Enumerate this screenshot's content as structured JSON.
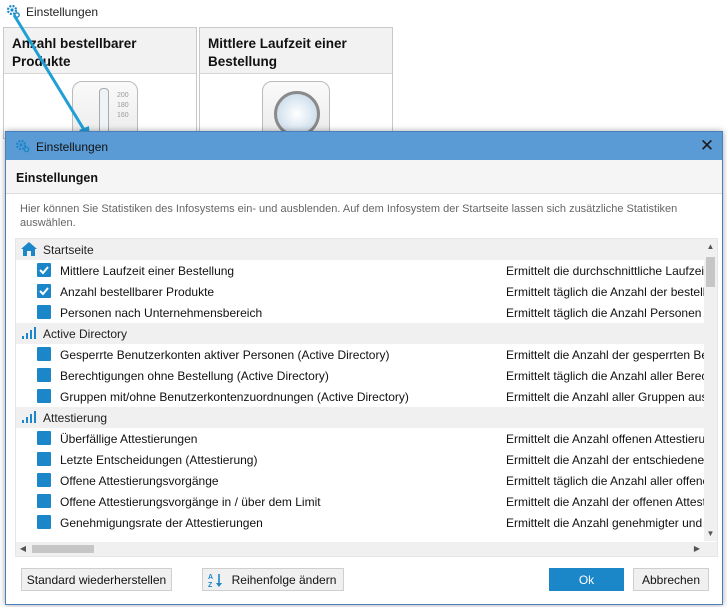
{
  "background": {
    "header_title": "Einstellungen",
    "tiles": [
      {
        "title": "Anzahl bestellbarer Produkte"
      },
      {
        "title": "Mittlere Laufzeit einer Bestellung"
      }
    ],
    "gauge_ticks": [
      "200",
      "180",
      "160"
    ]
  },
  "dialog": {
    "window_title": "Einstellungen",
    "close_glyph": "✕",
    "heading": "Einstellungen",
    "description": "Hier können Sie Statistiken des Infosystems ein- und ausblenden. Auf dem Infosystem der Startseite lassen sich zusätzliche Statistiken auswählen.",
    "rows": [
      {
        "type": "group",
        "icon": "home-icon",
        "label": "Startseite"
      },
      {
        "type": "item",
        "checked": true,
        "label": "Mittlere Laufzeit einer Bestellung",
        "desc": "Ermittelt die durchschnittliche Laufzeit"
      },
      {
        "type": "item",
        "checked": true,
        "label": "Anzahl bestellbarer Produkte",
        "desc": "Ermittelt täglich die Anzahl der bestellbaren"
      },
      {
        "type": "item",
        "checked": false,
        "label": "Personen nach Unternehmensbereich",
        "desc": "Ermittelt täglich die Anzahl Personen je"
      },
      {
        "type": "group",
        "icon": "signal-bars-icon",
        "label": "Active Directory"
      },
      {
        "type": "item",
        "checked": false,
        "label": "Gesperrte Benutzerkonten aktiver Personen (Active Directory)",
        "desc": "Ermittelt die Anzahl der gesperrten Benutzerkonten"
      },
      {
        "type": "item",
        "checked": false,
        "label": "Berechtigungen ohne Bestellung (Active Directory)",
        "desc": "Ermittelt täglich die Anzahl aller Berechtigungen"
      },
      {
        "type": "item",
        "checked": false,
        "label": "Gruppen mit/ohne Benutzerkontenzuordnungen (Active Directory)",
        "desc": "Ermittelt die Anzahl aller Gruppen aus"
      },
      {
        "type": "group",
        "icon": "signal-bars-icon",
        "label": "Attestierung"
      },
      {
        "type": "item",
        "checked": false,
        "label": "Überfällige Attestierungen",
        "desc": "Ermittelt die Anzahl offenen Attestierungen"
      },
      {
        "type": "item",
        "checked": false,
        "label": "Letzte Entscheidungen (Attestierung)",
        "desc": "Ermittelt die Anzahl der entschiedenen"
      },
      {
        "type": "item",
        "checked": false,
        "label": "Offene Attestierungsvorgänge",
        "desc": "Ermittelt täglich die Anzahl aller offenen"
      },
      {
        "type": "item",
        "checked": false,
        "label": "Offene Attestierungsvorgänge  in / über dem Limit",
        "desc": "Ermittelt die Anzahl der offenen Attestierungen"
      },
      {
        "type": "item",
        "checked": false,
        "label": "Genehmigungsrate der Attestierungen",
        "desc": "Ermittelt die Anzahl genehmigter und"
      }
    ],
    "buttons": {
      "restore": "Standard wiederherstellen",
      "reorder": "Reihenfolge ändern",
      "ok": "Ok",
      "cancel": "Abbrechen"
    },
    "colors": {
      "titlebar": "#5b9bd5",
      "accent": "#1b86c8"
    }
  }
}
